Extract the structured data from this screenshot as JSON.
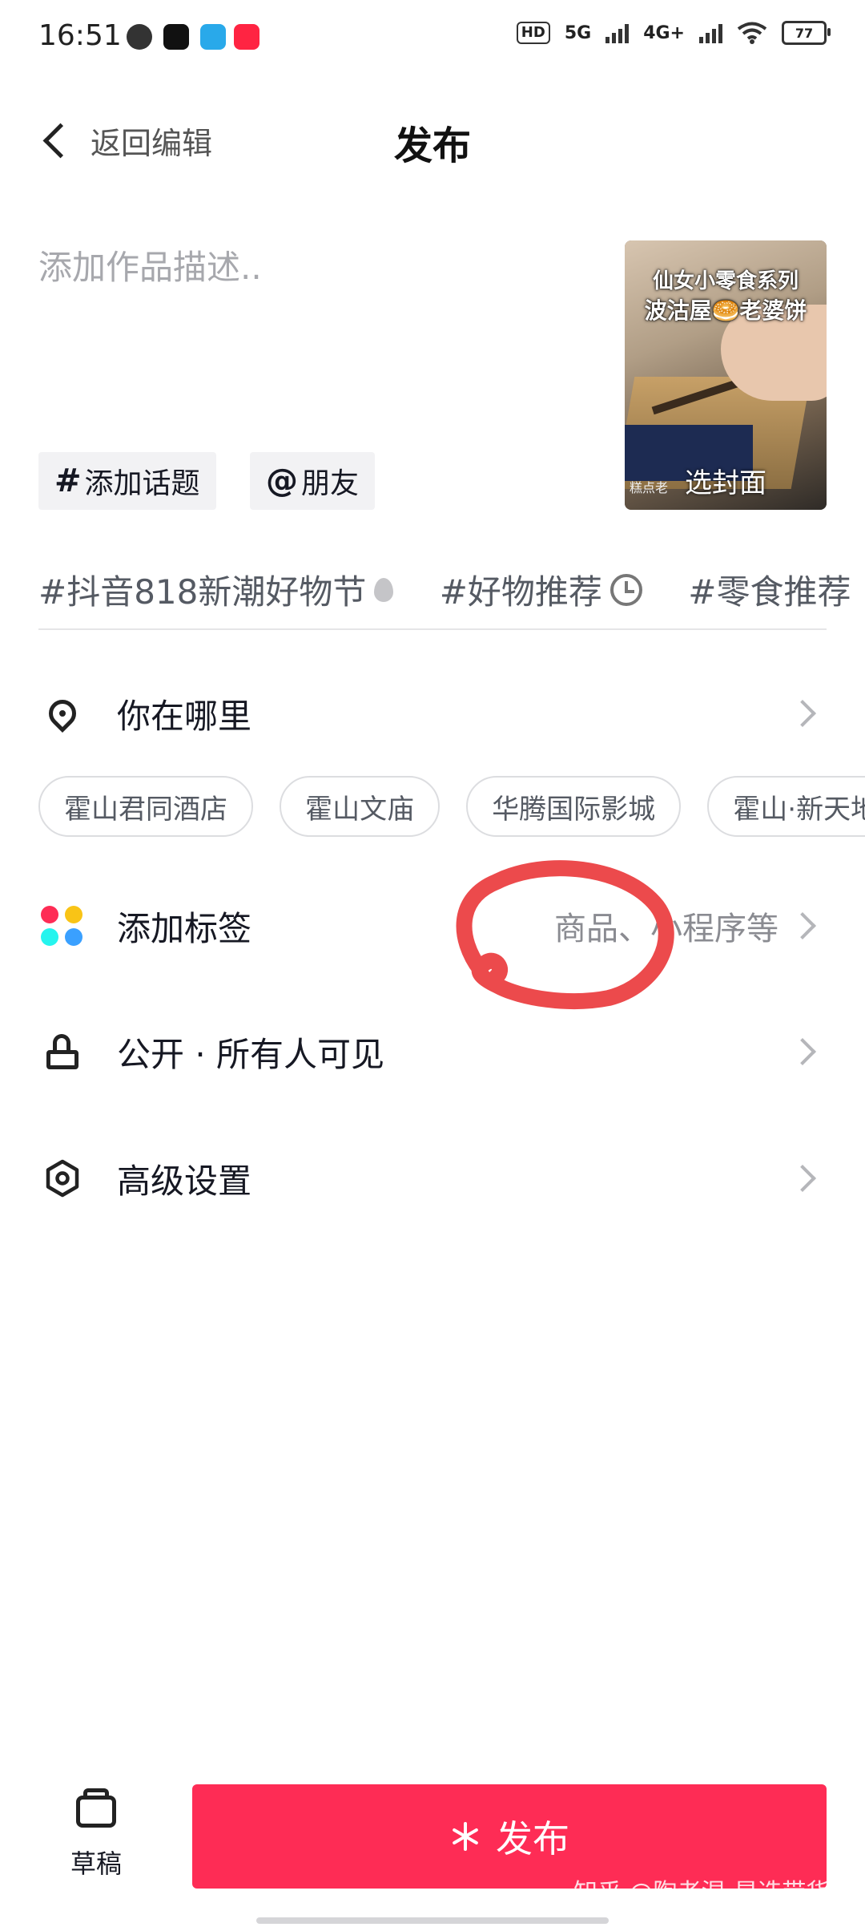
{
  "status_bar": {
    "time": "16:51",
    "signal_1": "5G",
    "signal_2": "4G+",
    "hd": "HD",
    "battery": "77"
  },
  "header": {
    "back_label": "返回编辑",
    "title": "发布"
  },
  "description": {
    "placeholder": "添加作品描述.."
  },
  "cover": {
    "line1": "仙女小零食系列",
    "line2": "波沽屋🥯老婆饼",
    "small": "糕点老",
    "select_label": "选封面"
  },
  "chips": {
    "topic": "添加话题",
    "topic_symbol": "#",
    "friend": "朋友",
    "friend_symbol": "@"
  },
  "hashtags": [
    {
      "text": "#抖音818新潮好物节",
      "icon": "flame-icon"
    },
    {
      "text": "#好物推荐",
      "icon": "clock-icon"
    },
    {
      "text": "#零食推荐",
      "icon": ""
    }
  ],
  "location": {
    "label": "你在哪里",
    "chips": [
      "霍山君同酒店",
      "霍山文庙",
      "华腾国际影城",
      "霍山·新天地"
    ]
  },
  "tags_row": {
    "label": "添加标签",
    "value": "商品、小程序等",
    "dot_colors": [
      "#fe2c55",
      "#f9c416",
      "#25f4ee",
      "#3aa0ff"
    ]
  },
  "privacy_row": {
    "label": "公开 · 所有人可见"
  },
  "advanced_row": {
    "label": "高级设置"
  },
  "bottom": {
    "drafts_label": "草稿",
    "publish_label": "发布",
    "publish_color": "#fe2c55"
  },
  "watermark": "知乎 @陶老湿-星选带货"
}
